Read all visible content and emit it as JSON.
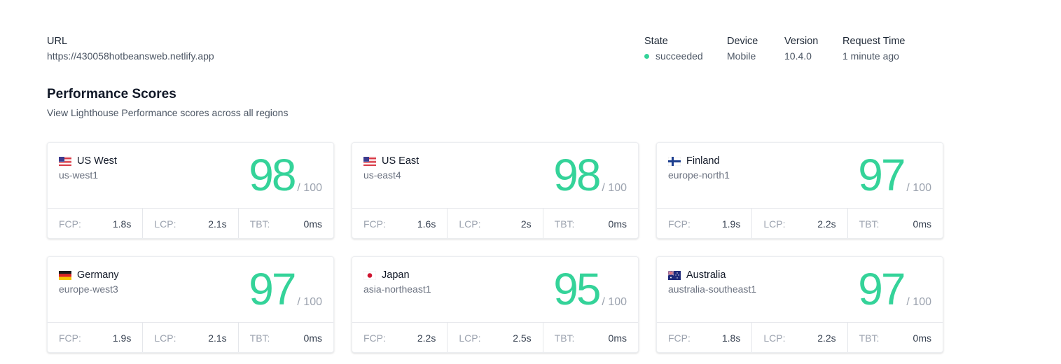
{
  "meta": {
    "url_label": "URL",
    "url_value": "https://430058hotbeansweb.netlify.app",
    "state_label": "State",
    "state_value": "succeeded",
    "device_label": "Device",
    "device_value": "Mobile",
    "version_label": "Version",
    "version_value": "10.4.0",
    "request_time_label": "Request Time",
    "request_time_value": "1 minute ago",
    "state_color": "#34d399"
  },
  "section": {
    "title": "Performance Scores",
    "subtitle": "View Lighthouse Performance scores across all regions"
  },
  "score_max": "/ 100",
  "metric_labels": {
    "fcp": "FCP:",
    "lcp": "LCP:",
    "tbt": "TBT:"
  },
  "regions": [
    {
      "name": "US West",
      "code": "us-west1",
      "flag": "us-flag-icon",
      "score": "98",
      "fcp": "1.8s",
      "lcp": "2.1s",
      "tbt": "0ms"
    },
    {
      "name": "US East",
      "code": "us-east4",
      "flag": "us-flag-icon",
      "score": "98",
      "fcp": "1.6s",
      "lcp": "2s",
      "tbt": "0ms"
    },
    {
      "name": "Finland",
      "code": "europe-north1",
      "flag": "finland-flag-icon",
      "score": "97",
      "fcp": "1.9s",
      "lcp": "2.2s",
      "tbt": "0ms"
    },
    {
      "name": "Germany",
      "code": "europe-west3",
      "flag": "germany-flag-icon",
      "score": "97",
      "fcp": "1.9s",
      "lcp": "2.1s",
      "tbt": "0ms"
    },
    {
      "name": "Japan",
      "code": "asia-northeast1",
      "flag": "japan-flag-icon",
      "score": "95",
      "fcp": "2.2s",
      "lcp": "2.5s",
      "tbt": "0ms"
    },
    {
      "name": "Australia",
      "code": "australia-southeast1",
      "flag": "australia-flag-icon",
      "score": "97",
      "fcp": "1.8s",
      "lcp": "2.2s",
      "tbt": "0ms"
    }
  ],
  "colors": {
    "score": "#34d399",
    "muted": "#9ca3af",
    "text": "#111827"
  }
}
